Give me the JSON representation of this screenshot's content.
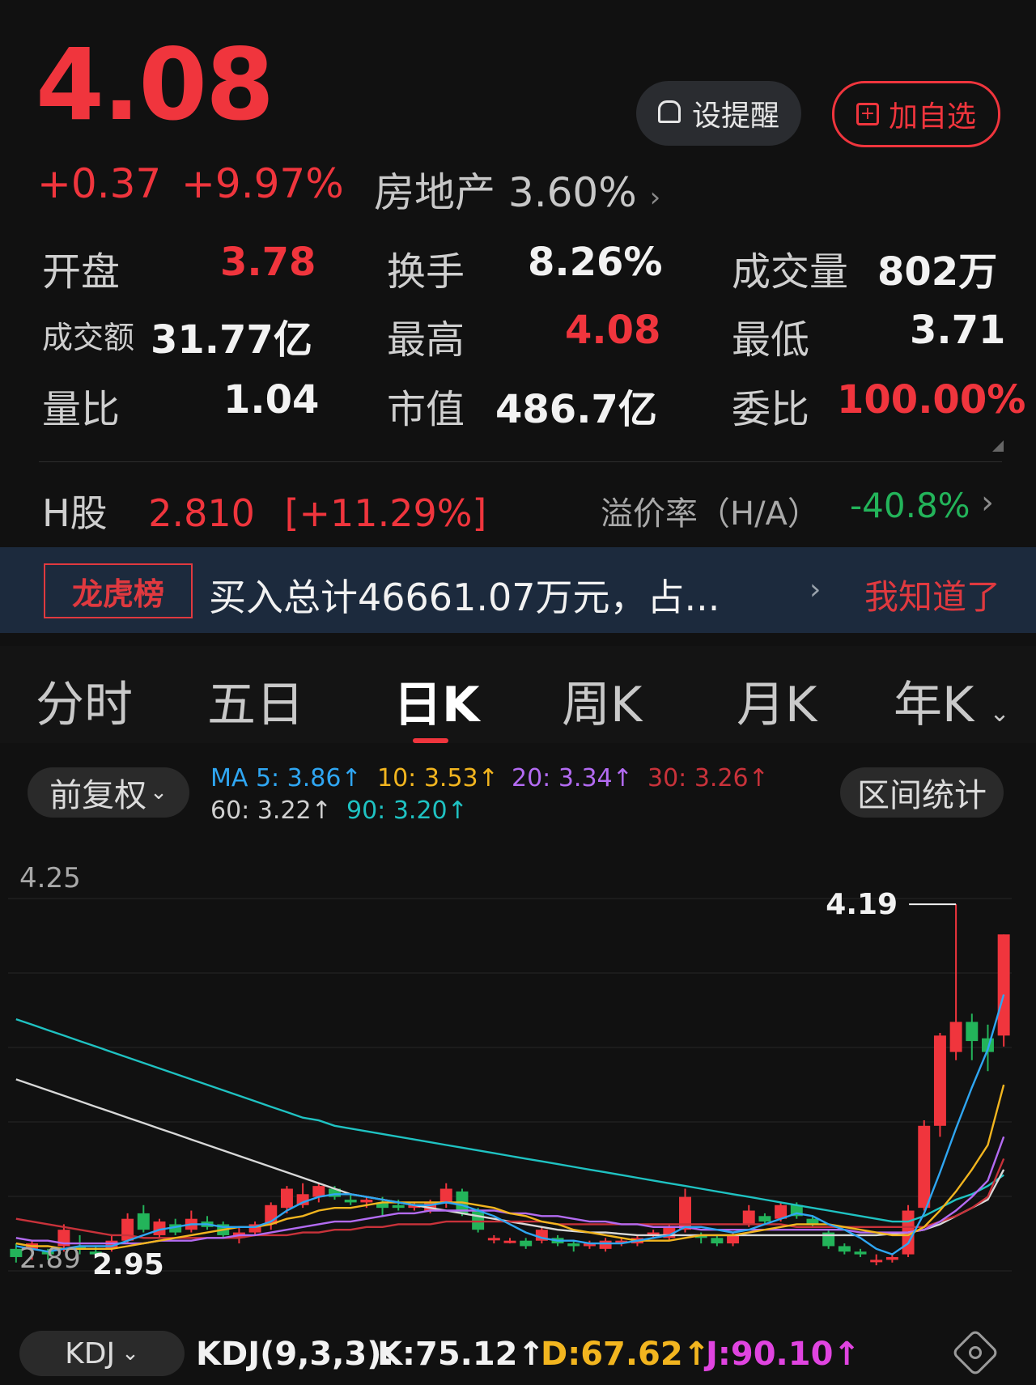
{
  "quote": {
    "price": "4.08",
    "change": "+0.37",
    "change_pct": "+9.97%",
    "sector_name": "房地产",
    "sector_pct": "3.60%",
    "alert_label": "设提醒",
    "watch_label": "加自选"
  },
  "stats": {
    "open_label": "开盘",
    "open_value": "3.78",
    "turnover_label": "换手",
    "turnover_value": "8.26%",
    "volume_label": "成交量",
    "volume_value": "802万",
    "amount_label": "成交额",
    "amount_value": "31.77亿",
    "high_label": "最高",
    "high_value": "4.08",
    "low_label": "最低",
    "low_value": "3.71",
    "volratio_label": "量比",
    "volratio_value": "1.04",
    "mktcap_label": "市值",
    "mktcap_value": "486.7亿",
    "bidratio_label": "委比",
    "bidratio_value": "100.00%"
  },
  "hshare": {
    "label": "H股",
    "price": "2.810",
    "pct": "[+11.29%]",
    "premium_label": "溢价率（H/A）",
    "premium_value": "-40.8%"
  },
  "banner": {
    "badge": "龙虎榜",
    "text": "买入总计46661.07万元，占...",
    "ack": "我知道了"
  },
  "tabs": [
    "分时",
    "五日",
    "日K",
    "周K",
    "月K",
    "年K"
  ],
  "chart_controls": {
    "adjust_label": "前复权",
    "range_label": "区间统计"
  },
  "ma": {
    "ma5": "MA 5: 3.86↑",
    "ma10": "10: 3.53↑",
    "ma20": "20: 3.34↑",
    "ma30": "30: 3.26↑",
    "ma60": "60: 3.22↑",
    "ma90": "90: 3.20↑"
  },
  "colors": {
    "up": "#f0353d",
    "down": "#23b45a",
    "ma5": "#2fa6f2",
    "ma10": "#f2b51f",
    "ma20": "#b36bf2",
    "ma30": "#c8323a",
    "ma60": "#d8d8d8",
    "ma90": "#1fc2c2"
  },
  "chart_data": {
    "type": "candlestick",
    "y_top_label": "4.25",
    "y_bottom_label": "2.89",
    "max_label": "4.19",
    "min_label": "2.95",
    "ylim": [
      2.82,
      4.3
    ],
    "candles": [
      {
        "o": 2.93,
        "c": 2.9,
        "h": 2.95,
        "l": 2.88
      },
      {
        "o": 2.93,
        "c": 2.95,
        "h": 2.96,
        "l": 2.89
      },
      {
        "o": 2.92,
        "c": 2.91,
        "h": 2.93,
        "l": 2.89
      },
      {
        "o": 2.94,
        "c": 3.0,
        "h": 3.02,
        "l": 2.92
      },
      {
        "o": 2.94,
        "c": 2.93,
        "h": 2.98,
        "l": 2.91
      },
      {
        "o": 2.92,
        "c": 2.91,
        "h": 2.94,
        "l": 2.9
      },
      {
        "o": 2.93,
        "c": 2.96,
        "h": 2.98,
        "l": 2.92
      },
      {
        "o": 2.96,
        "c": 3.04,
        "h": 3.06,
        "l": 2.95
      },
      {
        "o": 3.06,
        "c": 3.0,
        "h": 3.09,
        "l": 2.99
      },
      {
        "o": 2.98,
        "c": 3.03,
        "h": 3.04,
        "l": 2.97
      },
      {
        "o": 3.02,
        "c": 2.99,
        "h": 3.04,
        "l": 2.98
      },
      {
        "o": 3.0,
        "c": 3.04,
        "h": 3.07,
        "l": 2.99
      },
      {
        "o": 3.03,
        "c": 3.01,
        "h": 3.05,
        "l": 3.0
      },
      {
        "o": 3.02,
        "c": 2.98,
        "h": 3.03,
        "l": 2.97
      },
      {
        "o": 2.97,
        "c": 2.99,
        "h": 3.01,
        "l": 2.95
      },
      {
        "o": 2.99,
        "c": 3.02,
        "h": 3.03,
        "l": 2.98
      },
      {
        "o": 3.02,
        "c": 3.09,
        "h": 3.1,
        "l": 3.0
      },
      {
        "o": 3.08,
        "c": 3.15,
        "h": 3.16,
        "l": 3.06
      },
      {
        "o": 3.09,
        "c": 3.13,
        "h": 3.17,
        "l": 3.08
      },
      {
        "o": 3.12,
        "c": 3.16,
        "h": 3.17,
        "l": 3.1
      },
      {
        "o": 3.15,
        "c": 3.12,
        "h": 3.16,
        "l": 3.11
      },
      {
        "o": 3.11,
        "c": 3.1,
        "h": 3.13,
        "l": 3.09
      },
      {
        "o": 3.1,
        "c": 3.11,
        "h": 3.12,
        "l": 3.08
      },
      {
        "o": 3.1,
        "c": 3.08,
        "h": 3.12,
        "l": 3.05
      },
      {
        "o": 3.09,
        "c": 3.08,
        "h": 3.11,
        "l": 3.07
      },
      {
        "o": 3.08,
        "c": 3.09,
        "h": 3.1,
        "l": 3.07
      },
      {
        "o": 3.07,
        "c": 3.1,
        "h": 3.11,
        "l": 3.06
      },
      {
        "o": 3.1,
        "c": 3.15,
        "h": 3.17,
        "l": 3.08
      },
      {
        "o": 3.14,
        "c": 3.06,
        "h": 3.15,
        "l": 3.05
      },
      {
        "o": 3.07,
        "c": 3.0,
        "h": 3.08,
        "l": 2.99
      },
      {
        "o": 2.97,
        "c": 2.97,
        "h": 2.98,
        "l": 2.95
      },
      {
        "o": 2.96,
        "c": 2.96,
        "h": 2.97,
        "l": 2.95
      },
      {
        "o": 2.96,
        "c": 2.94,
        "h": 2.97,
        "l": 2.93
      },
      {
        "o": 2.96,
        "c": 3.0,
        "h": 3.01,
        "l": 2.95
      },
      {
        "o": 2.97,
        "c": 2.95,
        "h": 2.98,
        "l": 2.94
      },
      {
        "o": 2.95,
        "c": 2.94,
        "h": 2.96,
        "l": 2.92
      },
      {
        "o": 2.94,
        "c": 2.95,
        "h": 2.96,
        "l": 2.93
      },
      {
        "o": 2.93,
        "c": 2.96,
        "h": 2.97,
        "l": 2.92
      },
      {
        "o": 2.95,
        "c": 2.96,
        "h": 2.97,
        "l": 2.94
      },
      {
        "o": 2.95,
        "c": 2.97,
        "h": 2.98,
        "l": 2.94
      },
      {
        "o": 2.98,
        "c": 2.99,
        "h": 3.0,
        "l": 2.97
      },
      {
        "o": 2.97,
        "c": 3.01,
        "h": 3.02,
        "l": 2.96
      },
      {
        "o": 3.0,
        "c": 3.12,
        "h": 3.15,
        "l": 2.99
      },
      {
        "o": 2.98,
        "c": 2.97,
        "h": 2.99,
        "l": 2.95
      },
      {
        "o": 2.97,
        "c": 2.95,
        "h": 2.98,
        "l": 2.94
      },
      {
        "o": 2.95,
        "c": 2.98,
        "h": 2.99,
        "l": 2.94
      },
      {
        "o": 3.02,
        "c": 3.07,
        "h": 3.09,
        "l": 3.01
      },
      {
        "o": 3.05,
        "c": 3.03,
        "h": 3.06,
        "l": 3.02
      },
      {
        "o": 3.04,
        "c": 3.09,
        "h": 3.1,
        "l": 3.03
      },
      {
        "o": 3.09,
        "c": 3.05,
        "h": 3.1,
        "l": 3.04
      },
      {
        "o": 3.04,
        "c": 3.02,
        "h": 3.05,
        "l": 3.01
      },
      {
        "o": 2.99,
        "c": 2.94,
        "h": 3.0,
        "l": 2.93
      },
      {
        "o": 2.94,
        "c": 2.92,
        "h": 2.95,
        "l": 2.91
      },
      {
        "o": 2.92,
        "c": 2.91,
        "h": 2.93,
        "l": 2.9
      },
      {
        "o": 2.89,
        "c": 2.89,
        "h": 2.91,
        "l": 2.87
      },
      {
        "o": 2.89,
        "c": 2.9,
        "h": 2.91,
        "l": 2.88
      },
      {
        "o": 2.91,
        "c": 3.07,
        "h": 3.09,
        "l": 2.9
      },
      {
        "o": 3.08,
        "c": 3.38,
        "h": 3.4,
        "l": 3.07
      },
      {
        "o": 3.38,
        "c": 3.71,
        "h": 3.72,
        "l": 3.34
      },
      {
        "o": 3.65,
        "c": 3.76,
        "h": 4.19,
        "l": 3.62
      },
      {
        "o": 3.76,
        "c": 3.69,
        "h": 3.79,
        "l": 3.62
      },
      {
        "o": 3.7,
        "c": 3.65,
        "h": 3.75,
        "l": 3.58
      },
      {
        "o": 3.71,
        "c": 4.08,
        "h": 4.08,
        "l": 3.67
      }
    ],
    "ma_lines": {
      "ma5": [
        2.94,
        2.93,
        2.92,
        2.93,
        2.94,
        2.94,
        2.94,
        2.96,
        2.98,
        3.0,
        3.01,
        3.02,
        3.02,
        3.01,
        3.01,
        3.01,
        3.03,
        3.07,
        3.1,
        3.12,
        3.13,
        3.13,
        3.12,
        3.11,
        3.1,
        3.09,
        3.09,
        3.1,
        3.09,
        3.07,
        3.05,
        3.02,
        2.99,
        2.97,
        2.96,
        2.96,
        2.95,
        2.95,
        2.95,
        2.96,
        2.97,
        2.98,
        3.01,
        3.01,
        3.0,
        2.99,
        3.0,
        3.02,
        3.04,
        3.06,
        3.05,
        3.02,
        3.0,
        2.97,
        2.93,
        2.91,
        2.95,
        3.06,
        3.21,
        3.37,
        3.52,
        3.66,
        3.86
      ],
      "ma10": [
        2.95,
        2.94,
        2.94,
        2.93,
        2.93,
        2.93,
        2.93,
        2.94,
        2.95,
        2.96,
        2.97,
        2.98,
        2.99,
        3.0,
        3.01,
        3.01,
        3.02,
        3.04,
        3.05,
        3.07,
        3.08,
        3.08,
        3.09,
        3.1,
        3.1,
        3.1,
        3.1,
        3.1,
        3.1,
        3.09,
        3.08,
        3.06,
        3.05,
        3.03,
        3.02,
        3.0,
        2.99,
        2.98,
        2.97,
        2.96,
        2.96,
        2.96,
        2.97,
        2.98,
        2.98,
        2.98,
        2.99,
        3.0,
        3.01,
        3.02,
        3.02,
        3.02,
        3.01,
        3.0,
        2.99,
        2.98,
        2.98,
        3.01,
        3.07,
        3.14,
        3.22,
        3.31,
        3.53
      ],
      "ma20": [
        2.97,
        2.96,
        2.96,
        2.95,
        2.95,
        2.95,
        2.95,
        2.95,
        2.95,
        2.96,
        2.96,
        2.96,
        2.97,
        2.97,
        2.98,
        2.98,
        2.99,
        3.0,
        3.01,
        3.02,
        3.03,
        3.03,
        3.04,
        3.05,
        3.06,
        3.06,
        3.07,
        3.07,
        3.07,
        3.07,
        3.07,
        3.06,
        3.06,
        3.05,
        3.05,
        3.04,
        3.03,
        3.03,
        3.02,
        3.02,
        3.01,
        3.01,
        3.01,
        3.0,
        3.0,
        3.0,
        3.0,
        3.0,
        3.0,
        3.0,
        3.0,
        3.0,
        3.0,
        2.99,
        2.99,
        2.99,
        2.99,
        3.0,
        3.03,
        3.07,
        3.12,
        3.18,
        3.34
      ],
      "ma30": [
        3.04,
        3.03,
        3.02,
        3.01,
        3.0,
        2.99,
        2.98,
        2.98,
        2.97,
        2.97,
        2.97,
        2.97,
        2.97,
        2.97,
        2.97,
        2.98,
        2.98,
        2.98,
        2.99,
        2.99,
        3.0,
        3.0,
        3.01,
        3.01,
        3.02,
        3.02,
        3.02,
        3.03,
        3.03,
        3.03,
        3.03,
        3.03,
        3.03,
        3.03,
        3.02,
        3.02,
        3.02,
        3.02,
        3.02,
        3.02,
        3.02,
        3.02,
        3.02,
        3.02,
        3.02,
        3.02,
        3.02,
        3.02,
        3.02,
        3.01,
        3.01,
        3.01,
        3.01,
        3.01,
        3.01,
        3.01,
        3.01,
        3.01,
        3.03,
        3.05,
        3.08,
        3.12,
        3.26
      ],
      "ma60": [
        3.55,
        3.53,
        3.51,
        3.49,
        3.47,
        3.45,
        3.43,
        3.41,
        3.39,
        3.37,
        3.35,
        3.33,
        3.31,
        3.29,
        3.27,
        3.25,
        3.23,
        3.21,
        3.19,
        3.17,
        3.15,
        3.13,
        3.12,
        3.11,
        3.1,
        3.09,
        3.08,
        3.07,
        3.06,
        3.05,
        3.04,
        3.03,
        3.02,
        3.01,
        3.0,
        2.995,
        2.99,
        2.99,
        2.985,
        2.98,
        2.98,
        2.98,
        2.98,
        2.98,
        2.98,
        2.98,
        2.98,
        2.98,
        2.98,
        2.98,
        2.98,
        2.98,
        2.98,
        2.98,
        2.98,
        2.985,
        2.99,
        3.0,
        3.02,
        3.05,
        3.08,
        3.11,
        3.22
      ],
      "ma90": [
        3.77,
        3.75,
        3.73,
        3.71,
        3.69,
        3.67,
        3.65,
        3.63,
        3.61,
        3.59,
        3.57,
        3.55,
        3.53,
        3.51,
        3.49,
        3.47,
        3.45,
        3.43,
        3.41,
        3.4,
        3.38,
        3.37,
        3.36,
        3.35,
        3.34,
        3.33,
        3.32,
        3.31,
        3.3,
        3.29,
        3.28,
        3.27,
        3.26,
        3.25,
        3.24,
        3.23,
        3.22,
        3.21,
        3.2,
        3.19,
        3.18,
        3.17,
        3.16,
        3.15,
        3.14,
        3.13,
        3.12,
        3.11,
        3.1,
        3.09,
        3.08,
        3.07,
        3.06,
        3.05,
        3.04,
        3.03,
        3.03,
        3.05,
        3.08,
        3.11,
        3.13,
        3.16,
        3.2
      ]
    }
  },
  "kdj": {
    "label": "KDJ",
    "params": "KDJ(9,3,3):",
    "k": "K:75.12↑",
    "d": "D:67.62↑",
    "j": "J:90.10↑",
    "k_color": "#ffffff",
    "d_color": "#f2b51f",
    "j_color": "#e044e0"
  }
}
